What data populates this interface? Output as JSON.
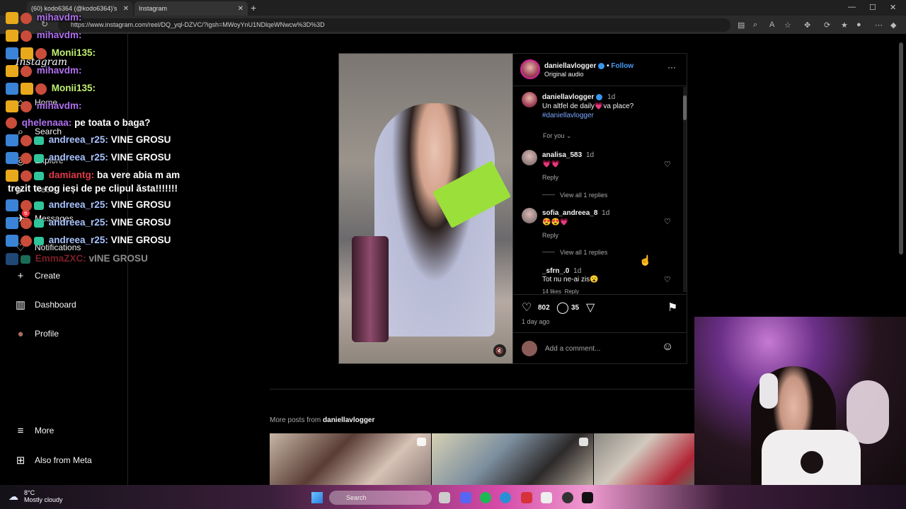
{
  "browser": {
    "tabs": [
      {
        "label": "(60) kodo6364 (@kodo6364)'s"
      },
      {
        "label": "Instagram"
      }
    ],
    "new_tab": "+",
    "url": "https://www.instagram.com/reel/DQ_yql-DZVC/?igsh=MWoyYnU1NDlqeWNwcw%3D%3D",
    "window_controls": {
      "minimize": "—",
      "maximize": "☐",
      "close": "✕"
    }
  },
  "sidebar": {
    "logo": "Instagram",
    "items": [
      {
        "label": "Home",
        "icon": "home-icon",
        "glyph": "⌂"
      },
      {
        "label": "Search",
        "icon": "search-icon",
        "glyph": "⌕"
      },
      {
        "label": "Explore",
        "icon": "explore-icon",
        "glyph": "◎"
      },
      {
        "label": "Reels",
        "icon": "reels-icon",
        "glyph": "▶"
      },
      {
        "label": "Messages",
        "icon": "messages-icon",
        "glyph": "✈"
      },
      {
        "label": "Notifications",
        "icon": "heart-icon",
        "glyph": "♡"
      },
      {
        "label": "Create",
        "icon": "plus-icon",
        "glyph": "+"
      },
      {
        "label": "Dashboard",
        "icon": "dashboard-icon",
        "glyph": "▥"
      },
      {
        "label": "Profile",
        "icon": "avatar-icon",
        "glyph": "●"
      }
    ],
    "bottom": [
      {
        "label": "More",
        "icon": "menu-icon",
        "glyph": "≡"
      },
      {
        "label": "Also from Meta",
        "icon": "meta-icon",
        "glyph": "⊞"
      }
    ],
    "messages_badge": "6"
  },
  "chat": [
    {
      "user": "mihavdm:",
      "color": "#b070f0",
      "msg": ""
    },
    {
      "user": "mihavdm:",
      "color": "#b070f0",
      "msg": ""
    },
    {
      "user": "Monii135:",
      "color": "#c0f070",
      "msg": ""
    },
    {
      "user": "mihavdm:",
      "color": "#b070f0",
      "msg": ""
    },
    {
      "user": "Monii135:",
      "color": "#c0f070",
      "msg": ""
    },
    {
      "user": "mihavdm:",
      "color": "#b070f0",
      "msg": ""
    },
    {
      "user": "qhelenaaa:",
      "color": "#b070f0",
      "msg": "pe toata o baga?"
    },
    {
      "user": "andreea_r25:",
      "color": "#a9c3ff",
      "msg": "VINE GROSU"
    },
    {
      "user": "andreea_r25:",
      "color": "#a9c3ff",
      "msg": "VINE GROSU"
    },
    {
      "user": "damiantg:",
      "color": "#e03a4a",
      "msg": "ba vere abia m am"
    },
    {
      "user": "",
      "color": "#ffffff",
      "msg": "trezit te rog ieși de pe clipul ăsta!!!!!!!"
    },
    {
      "user": "andreea_r25:",
      "color": "#a9c3ff",
      "msg": "VINE GROSU"
    },
    {
      "user": "andreea_r25:",
      "color": "#a9c3ff",
      "msg": "VINE GROSU"
    },
    {
      "user": "andreea_r25:",
      "color": "#a9c3ff",
      "msg": "VINE GROSU"
    },
    {
      "user": "EmmaZXC:",
      "color": "#e03a4a",
      "msg": "vINE GROSU"
    }
  ],
  "post": {
    "author": "daniellavlogger",
    "follow": "Follow",
    "audio": "Original audio",
    "more": "···",
    "caption_time": "1d",
    "caption": "Un altfel de daily💗va place?",
    "hashtag": "#daniellavlogger",
    "for_you": "For you",
    "comments": [
      {
        "user": "analisa_583",
        "time": "1d",
        "text": "💗💗",
        "reply": "Reply",
        "view_replies": "View all 1 replies"
      },
      {
        "user": "sofia_andreea_8",
        "time": "1d",
        "text": "😍😍💗",
        "reply": "Reply",
        "view_replies": "View all 1 replies"
      },
      {
        "user": "_sfrn_.0",
        "time": "1d",
        "text": "Tot nu ne-ai zis😮",
        "likes": "14 likes",
        "reply": "Reply"
      }
    ],
    "likes": "802",
    "comments_count": "35",
    "posted": "1 day ago",
    "add_comment": "Add a comment...",
    "mute": "🔇"
  },
  "more_posts": {
    "label": "More posts from",
    "author": "daniellavlogger"
  },
  "taskbar": {
    "temperature": "8°C",
    "weather": "Mostly cloudy",
    "search_placeholder": "Search"
  }
}
